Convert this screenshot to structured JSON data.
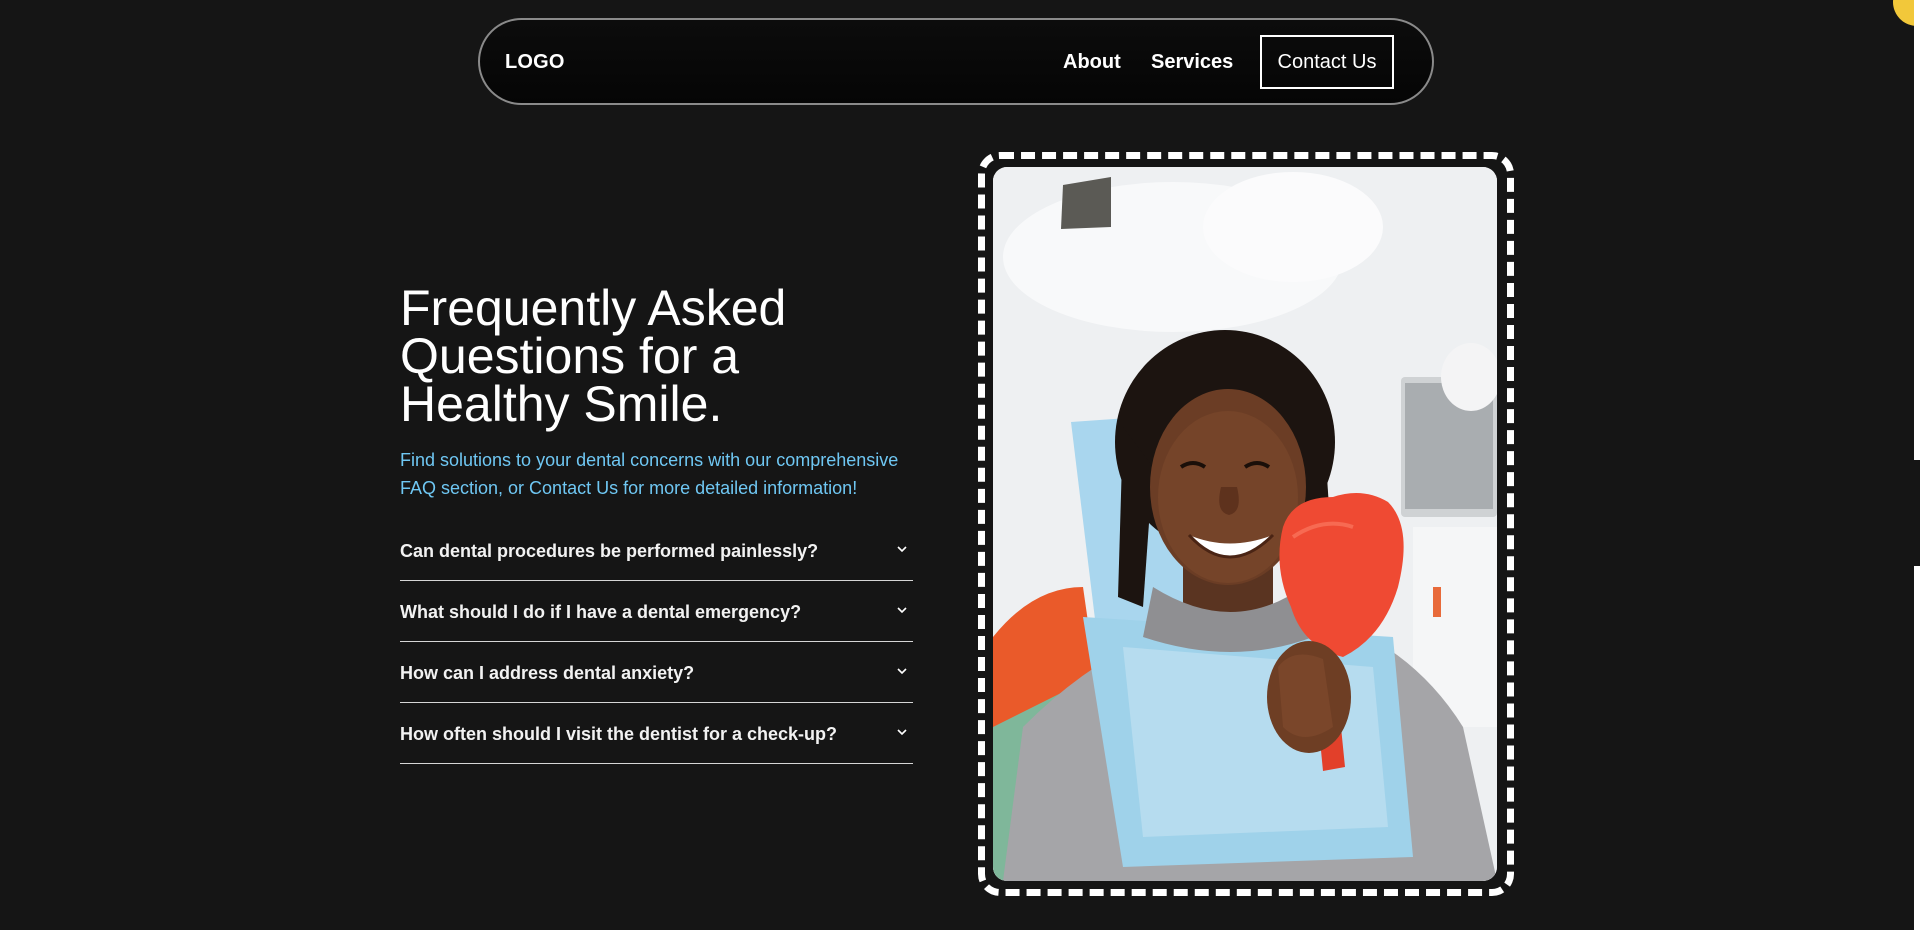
{
  "nav": {
    "logo": "LOGO",
    "links": [
      "About",
      "Services"
    ],
    "contact_button": "Contact Us"
  },
  "faq": {
    "title_lines": [
      "Frequently Asked",
      "Questions for a",
      "Healthy Smile."
    ],
    "subtitle_lines": [
      "Find solutions to your dental concerns with our comprehensive",
      "FAQ section, or Contact Us for more detailed information!"
    ],
    "items": [
      {
        "question": "Can dental procedures be performed painlessly?",
        "icon": "chevron-down-icon"
      },
      {
        "question": "What should I do if I have a dental emergency?",
        "icon": "chevron-down-icon"
      },
      {
        "question": "How can I address dental anxiety?",
        "icon": "chevron-down-icon"
      },
      {
        "question": "How often should I visit the dentist for a check-up?",
        "icon": "chevron-down-icon"
      }
    ]
  },
  "colors": {
    "background": "#151515",
    "accent_text": "#6fc7f3",
    "corner_dot": "#f2c83a",
    "frame": "#ffffff"
  }
}
